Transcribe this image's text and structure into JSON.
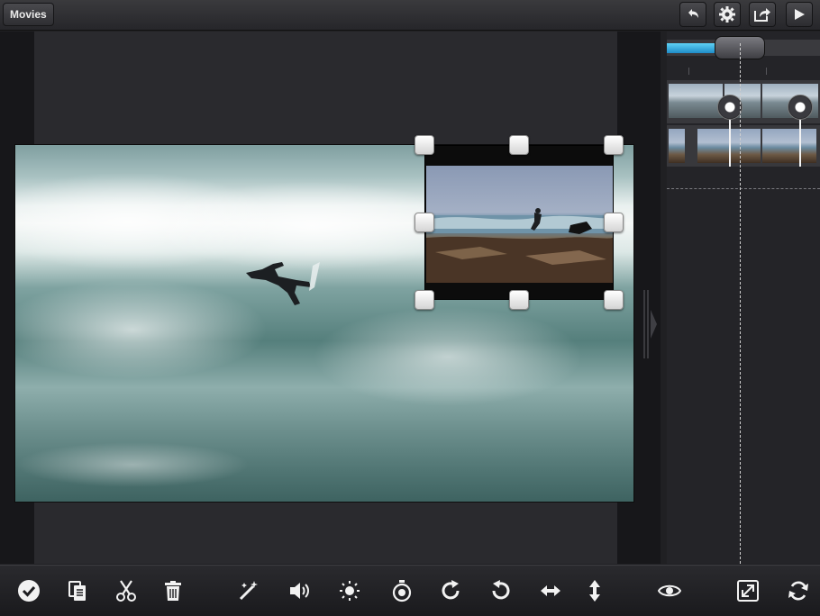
{
  "topbar": {
    "movies_label": "Movies",
    "buttons": [
      {
        "name": "undo-button",
        "icon": "undo-icon"
      },
      {
        "name": "settings-button",
        "icon": "gear-icon"
      },
      {
        "name": "share-button",
        "icon": "share-icon"
      },
      {
        "name": "play-button",
        "icon": "play-icon"
      }
    ]
  },
  "timeline": {
    "scrubber_progress": 0.35
  },
  "toolbar": {
    "items": [
      "checkmark-icon",
      "copy-paste-icon",
      "scissors-icon",
      "trash-icon",
      "magic-wand-icon",
      "volume-icon",
      "brightness-icon",
      "stopwatch-icon",
      "rotate-clockwise-icon",
      "rotate-counterclockwise-icon",
      "flip-horizontal-icon",
      "flip-vertical-icon",
      "eye-icon",
      "fullscreen-icon",
      "refresh-icon"
    ]
  },
  "colors": {
    "accent": "#2ea6e0",
    "background": "#202023"
  }
}
